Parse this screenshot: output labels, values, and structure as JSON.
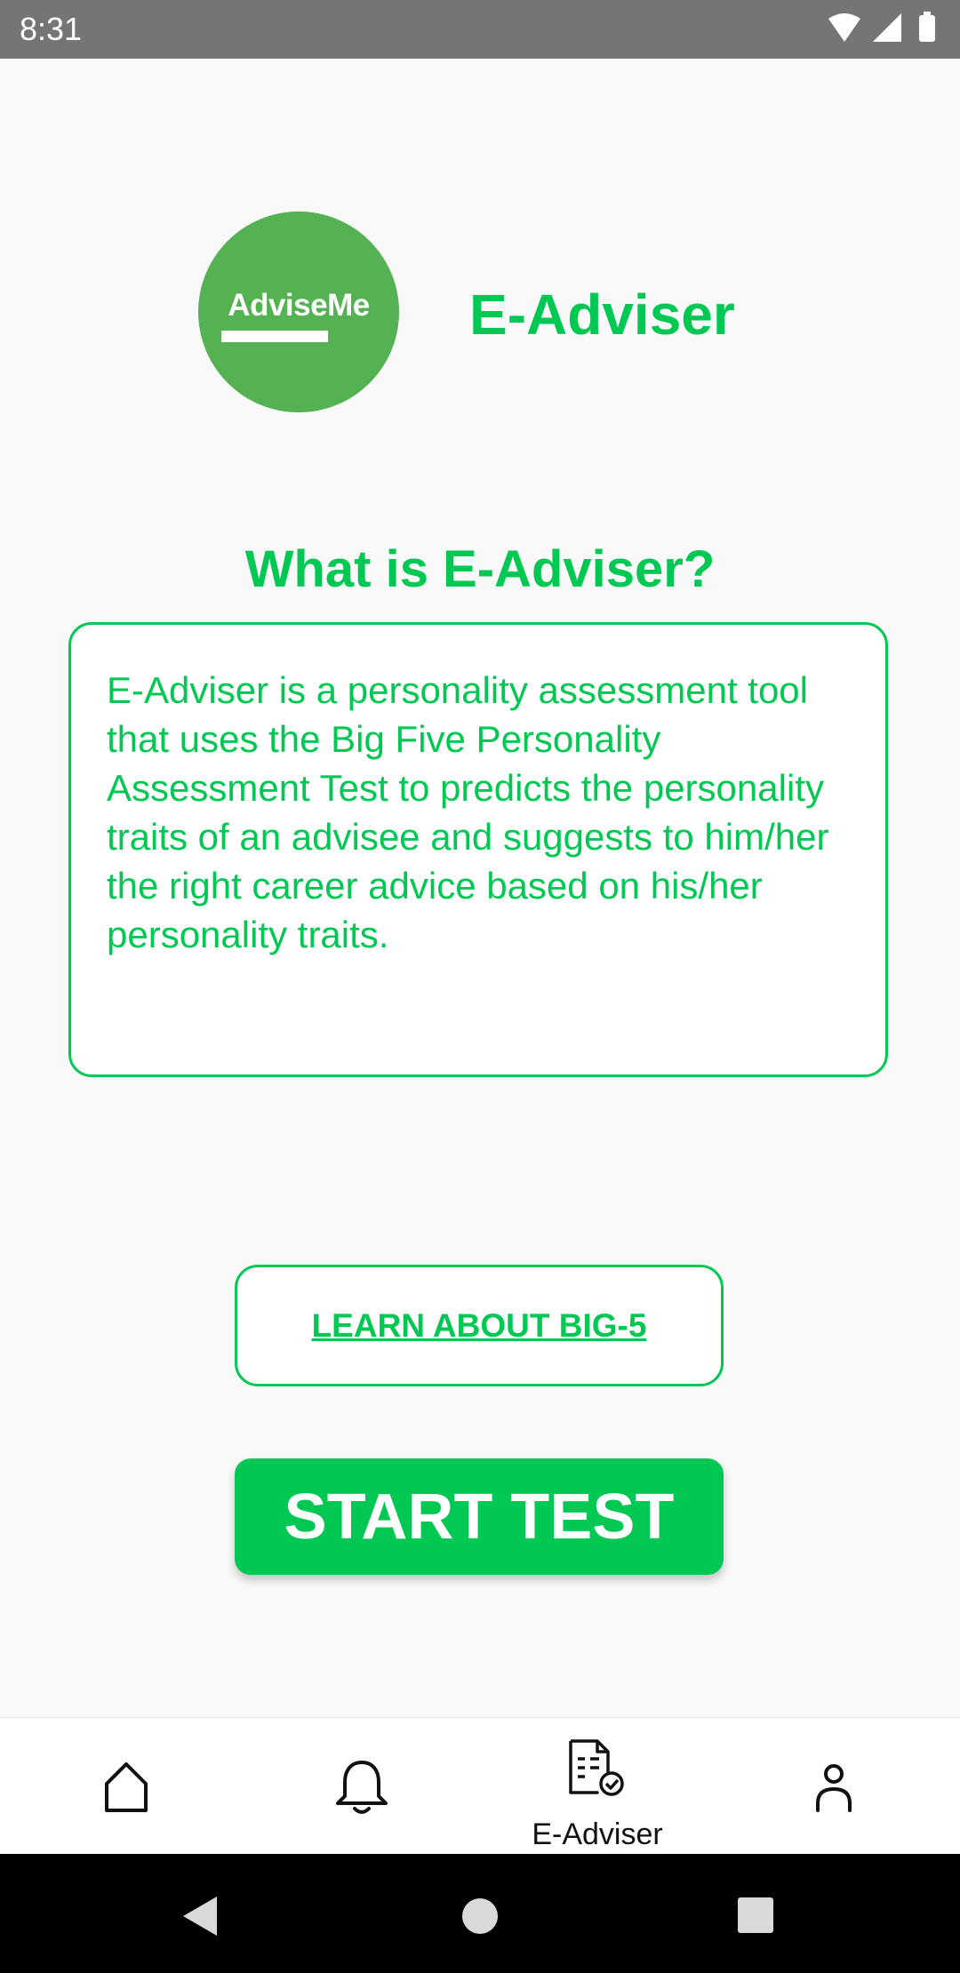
{
  "status_bar": {
    "time": "8:31",
    "icons": [
      "wifi-icon",
      "cell-signal-icon",
      "battery-icon"
    ]
  },
  "header": {
    "logo_text": "AdviseMe",
    "app_title": "E-Adviser"
  },
  "main": {
    "heading": "What is E-Adviser?",
    "description": "E-Adviser is a personality assessment tool that uses the Big Five Personality Assessment Test to predicts the personality traits of an advisee and suggests to him/her the right career advice based on his/her personality traits.",
    "learn_button_label": "LEARN ABOUT BIG-5",
    "start_button_label": "START TEST"
  },
  "bottom_nav": {
    "items": [
      {
        "icon": "home-icon",
        "label": ""
      },
      {
        "icon": "bell-icon",
        "label": ""
      },
      {
        "icon": "document-check-icon",
        "label": "E-Adviser",
        "active": true
      },
      {
        "icon": "person-icon",
        "label": ""
      }
    ]
  },
  "system_nav": {
    "buttons": [
      "back-icon",
      "home-circle-icon",
      "recents-icon"
    ]
  },
  "colors": {
    "accent": "#00c853",
    "logo_green": "#54b253",
    "status_bar": "#757575"
  }
}
